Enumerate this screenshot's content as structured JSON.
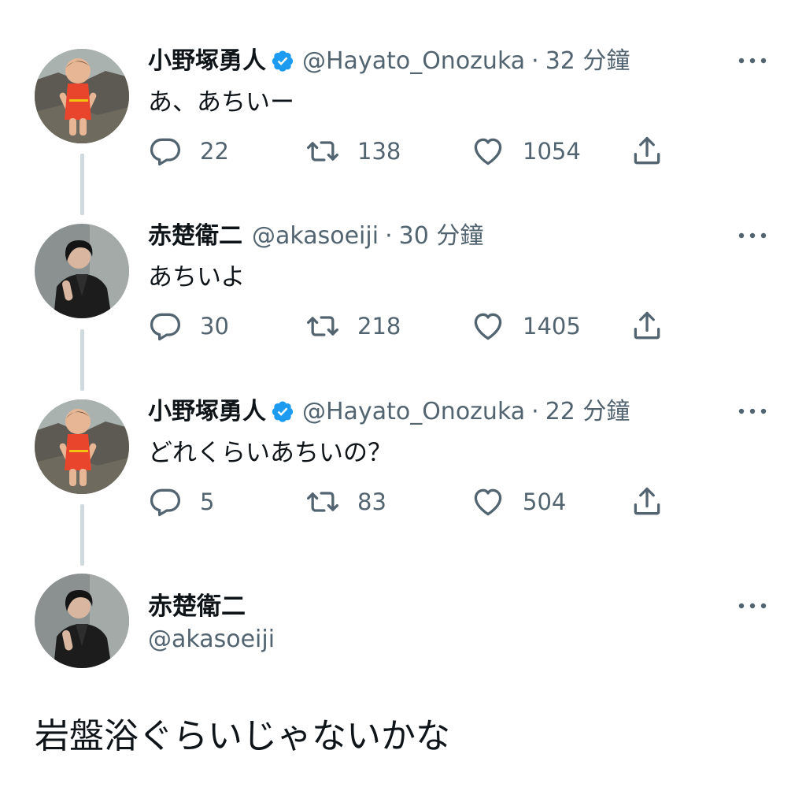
{
  "tweets": [
    {
      "name": "小野塚勇人",
      "verified": true,
      "handle": "@Hayato_Onozuka",
      "sep": "·",
      "time": "32 分鐘",
      "text": "あ、あちいー",
      "replies": "22",
      "retweets": "138",
      "likes": "1054",
      "avatar": "baby-swimsuit-photo"
    },
    {
      "name": "赤楚衛二",
      "verified": false,
      "handle": "@akasoeiji",
      "sep": "·",
      "time": "30 分鐘",
      "text": "あちいよ",
      "replies": "30",
      "retweets": "218",
      "likes": "1405",
      "avatar": "man-dark-jacket-photo"
    },
    {
      "name": "小野塚勇人",
      "verified": true,
      "handle": "@Hayato_Onozuka",
      "sep": "·",
      "time": "22 分鐘",
      "text": "どれくらいあちいの？",
      "replies": "5",
      "retweets": "83",
      "likes": "504",
      "avatar": "baby-swimsuit-photo"
    }
  ],
  "focused": {
    "name": "赤楚衛二",
    "handle": "@akasoeiji",
    "text": "岩盤浴ぐらいじゃないかな",
    "avatar": "man-dark-jacket-photo"
  },
  "icons": {
    "reply": "reply-icon",
    "retweet": "retweet-icon",
    "like": "heart-icon",
    "share": "share-icon",
    "more": "more-dots-icon",
    "verified": "verified-badge-icon"
  },
  "colors": {
    "text": "#0f1419",
    "secondary": "#536471",
    "verified": "#1d9bf0",
    "thread_line": "#cfd9de",
    "background": "#ffffff"
  }
}
